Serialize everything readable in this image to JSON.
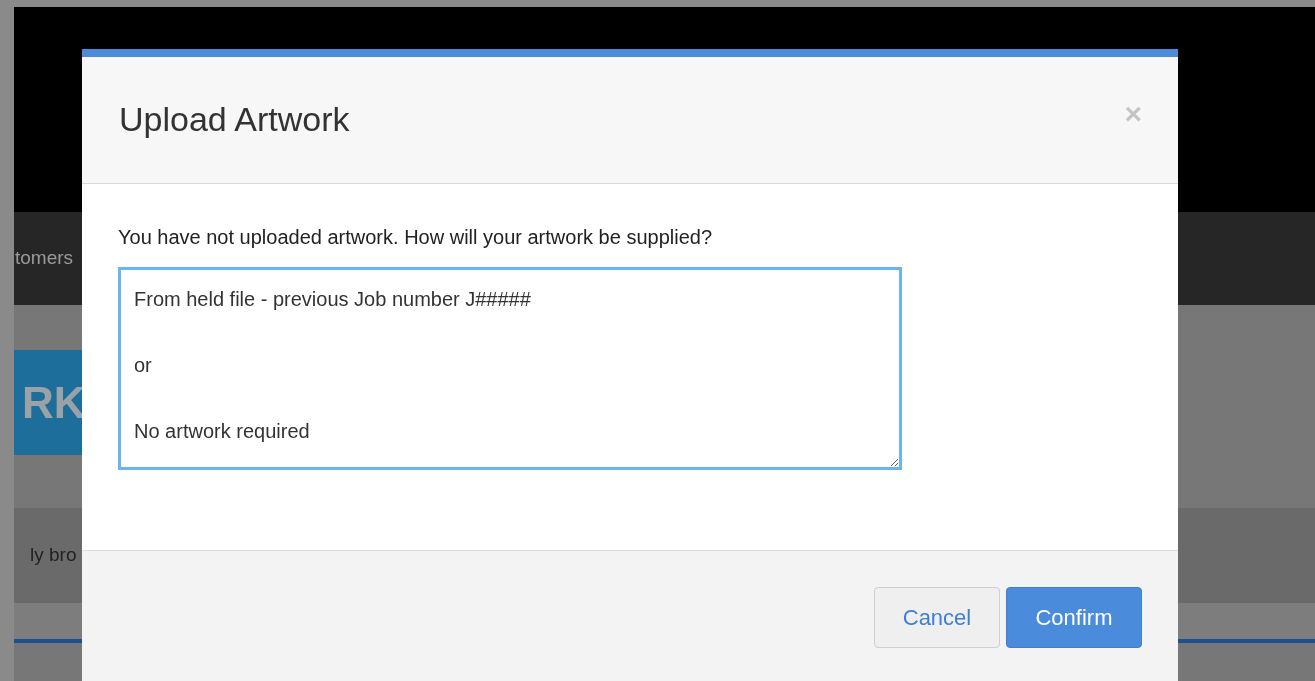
{
  "background": {
    "nav_text": "tomers",
    "banner_text": "RK",
    "row_text": "ly bro"
  },
  "modal": {
    "title": "Upload Artwork",
    "close": "×",
    "prompt": "You have not uploaded artwork. How will your artwork be supplied?",
    "answer": {
      "value": "From held file - previous Job number J#####\n\nor\n\nNo artwork required",
      "focused": true
    },
    "buttons": [
      {
        "label": "Cancel",
        "kind": "default"
      },
      {
        "label": "Confirm",
        "kind": "primary"
      }
    ]
  }
}
